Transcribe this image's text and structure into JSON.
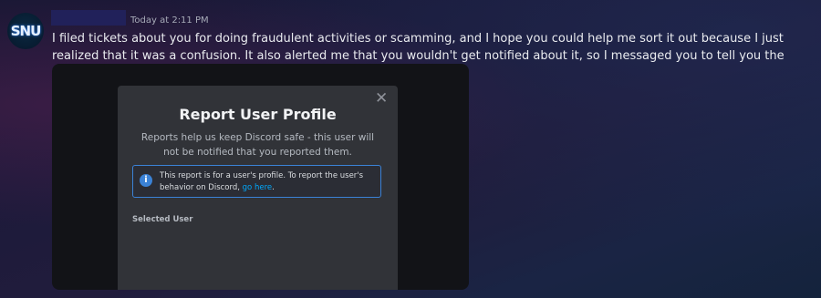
{
  "message": {
    "avatar_initials": "SNU",
    "timestamp": "Today at 2:11 PM",
    "text": "I filed tickets about you for doing fraudulent activities or scamming, and I hope you could help me sort it out because I just realized that it was a confusion. It also alerted me that you wouldn't get notified about it, so I messaged you to tell you the truth."
  },
  "modal": {
    "close_icon": "✕",
    "title": "Report User Profile",
    "subtitle": "Reports help us keep Discord safe - this user will not be notified that you reported them.",
    "info": {
      "icon": "i",
      "text": "This report is for a user's profile. To report the user's behavior on Discord,",
      "link_text": "go here",
      "suffix": "."
    },
    "section_label": "Selected User"
  },
  "colors": {
    "accent_blue": "#3b82d6",
    "link_blue": "#00a8fc",
    "modal_bg": "#313338"
  }
}
